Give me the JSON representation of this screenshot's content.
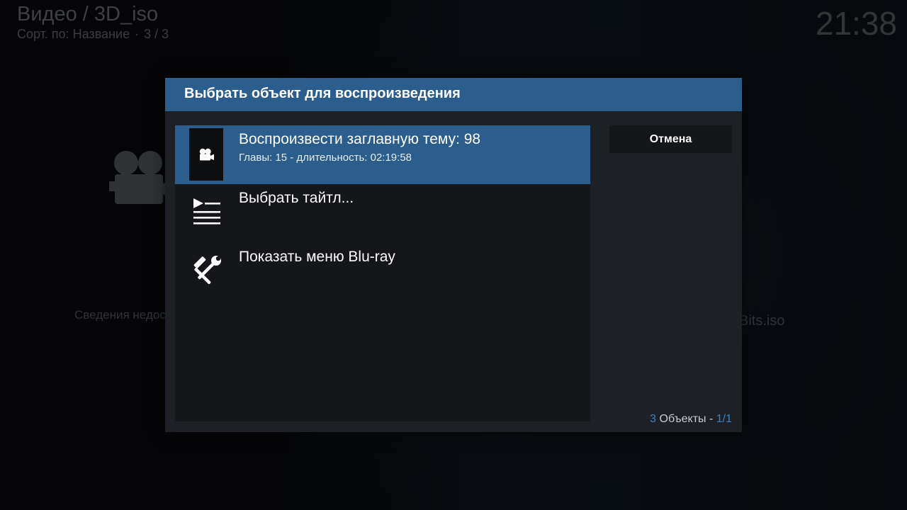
{
  "header": {
    "title": "Видео / 3D_iso",
    "sort_label": "Сорт. по: Название",
    "separator": "·",
    "position": "3 / 3",
    "clock": "21:38"
  },
  "background": {
    "info_left": "Сведения недос",
    "info_right": "Bits.iso",
    "camera_icon": "video-camera-icon"
  },
  "dialog": {
    "title": "Выбрать объект для воспроизведения",
    "cancel_label": "Отмена",
    "items": [
      {
        "title": "Воспроизвести заглавную тему: 98",
        "subtitle": "Главы: 15 - длительность: 02:19:58",
        "icon": "video-camera-icon",
        "selected": true
      },
      {
        "title": "Выбрать тайтл...",
        "subtitle": "",
        "icon": "playlist-icon",
        "selected": false
      },
      {
        "title": "Показать меню Blu-ray",
        "subtitle": "",
        "icon": "tools-icon",
        "selected": false
      }
    ],
    "count": {
      "number": "3",
      "label": "Объекты",
      "separator": "-",
      "page": "1/1"
    }
  },
  "colors": {
    "accent": "#2b5d8d",
    "accent_text": "#3b83c4",
    "dialog_bg": "#1d2024",
    "panel_bg": "#141619"
  }
}
